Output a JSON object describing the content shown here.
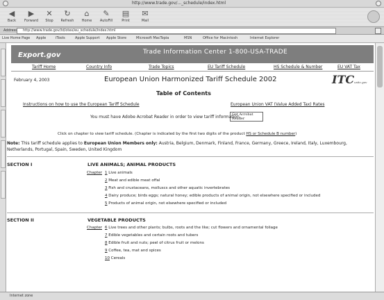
{
  "window": {
    "title": "http://www.trade.gov/..._schedule/index.html"
  },
  "toolbar": {
    "buttons": [
      {
        "label": "Back",
        "icon": "back-arrow"
      },
      {
        "label": "Forward",
        "icon": "forward-arrow"
      },
      {
        "label": "Stop",
        "icon": "stop"
      },
      {
        "label": "Refresh",
        "icon": "refresh"
      },
      {
        "label": "Home",
        "icon": "home"
      },
      {
        "label": "AutoFill",
        "icon": "autofill"
      },
      {
        "label": "Print",
        "icon": "print"
      },
      {
        "label": "Mail",
        "icon": "mail"
      }
    ]
  },
  "address": {
    "label": "Address",
    "url": "http://www.trade.gov/td/otex/eu_schedule/index.html"
  },
  "favorites": [
    "Live Home Page",
    "Apple",
    "iTools",
    "Apple Support",
    "Apple Store",
    "Microsoft MacTopia",
    "MSN",
    "Office for Macintosh",
    "Internet Explorer"
  ],
  "status": {
    "text": "Internet zone"
  },
  "banner": {
    "logo": "Export.gov",
    "title": "Trade Information Center 1-800-USA-TRADE"
  },
  "nav": [
    "Tariff Home",
    "Country Info",
    "Trade Topics",
    "EU Tariff Schedule",
    "HS Schedule & Number",
    "EU VAT Tax"
  ],
  "page": {
    "date": "February 4, 2003",
    "title": "European Union Harmonized Tariff Schedule 2002",
    "logo": "ITC",
    "logo_sub": "usitc.gov",
    "toc": "Table of Contents",
    "instructions_link": "Instructions on how to use the European Tariff Schedule",
    "vat_link": "European Union VAT (Value Added Tax) Rates",
    "acrobat_text": "You must have Adobe Acrobat Reader in order to view tariff information.",
    "acrobat_logo": "Get Acrobat Reader",
    "click_text": "Click on chapter to view tariff schedule. (Chapter is indicated by the first two digits of the product",
    "click_link": "HS or Schedule B number",
    "click_end": ")",
    "note_label": "Note:",
    "note_text": "This tariff schedule applies to",
    "note_bold": "European Union Members only:",
    "note_rest": "Austria, Belgium, Denmark, Finland, France, Germany, Greece, Ireland, Italy, Luxembourg, Netherlands, Portugal, Spain, Sweden, United Kingdom"
  },
  "sections": [
    {
      "label": "SECTION I",
      "name": "LIVE ANIMALS; ANIMAL PRODUCTS",
      "chapters": [
        {
          "num": "1",
          "desc": "Live animals"
        },
        {
          "num": "2",
          "desc": "Meat and edible meat offal"
        },
        {
          "num": "3",
          "desc": "Fish and crustaceans, molluscs and other aquatic invertebrates"
        },
        {
          "num": "4",
          "desc": "Dairy produce; birds eggs; natural honey; edible products of animal origin, not elsewhere specified or included"
        },
        {
          "num": "5",
          "desc": "Products of animal origin, not elsewhere specified or included"
        }
      ]
    },
    {
      "label": "SECTION II",
      "name": "VEGETABLE PRODUCTS",
      "chapters": [
        {
          "num": "6",
          "desc": "Live trees and other plants; bulbs, roots and the like; cut flowers and ornamental foliage"
        },
        {
          "num": "7",
          "desc": "Edible vegetables and certain roots and tubers"
        },
        {
          "num": "8",
          "desc": "Edible fruit and nuts; peel of citrus fruit or melons"
        },
        {
          "num": "9",
          "desc": "Coffee, tea, mat and spices"
        },
        {
          "num": "10",
          "desc": "Cereals"
        }
      ]
    }
  ],
  "chapter_label": "Chapter"
}
